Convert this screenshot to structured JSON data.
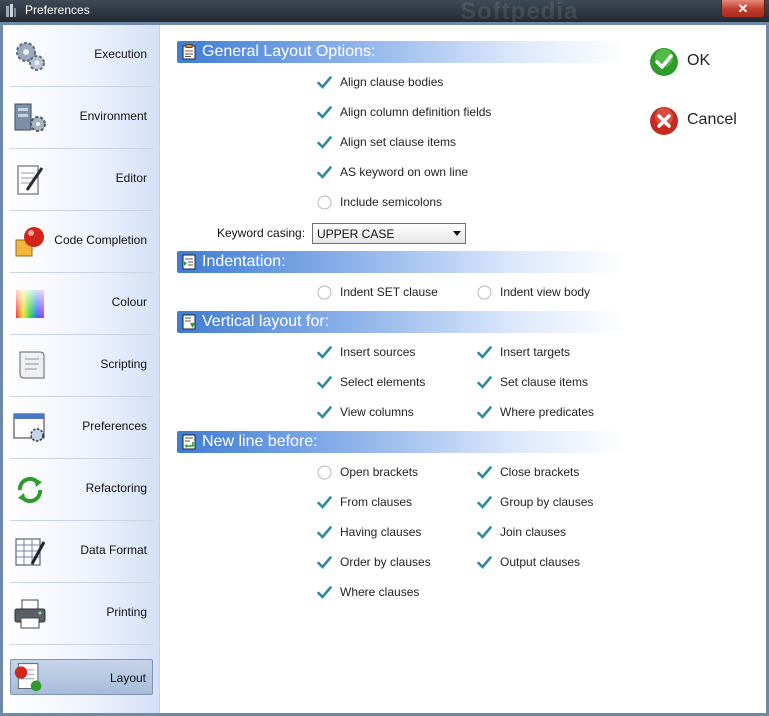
{
  "window": {
    "title": "Preferences",
    "watermark": "Softpedia"
  },
  "sidebar": {
    "items": [
      {
        "label": "Execution",
        "icon": "gears-icon"
      },
      {
        "label": "Environment",
        "icon": "server-gear-icon"
      },
      {
        "label": "Editor",
        "icon": "notepad-pen-icon"
      },
      {
        "label": "Code Completion",
        "icon": "cube-ball-icon"
      },
      {
        "label": "Colour",
        "icon": "color-gradient-icon"
      },
      {
        "label": "Scripting",
        "icon": "scroll-icon"
      },
      {
        "label": "Preferences",
        "icon": "window-gear-icon"
      },
      {
        "label": "Refactoring",
        "icon": "refresh-arrows-icon"
      },
      {
        "label": "Data Format",
        "icon": "spreadsheet-pen-icon"
      },
      {
        "label": "Printing",
        "icon": "printer-icon"
      },
      {
        "label": "Layout",
        "icon": "layout-doc-icon",
        "selected": true
      }
    ]
  },
  "sections": {
    "general": {
      "title": "General Layout Options:"
    },
    "indentation": {
      "title": "Indentation:"
    },
    "vertical": {
      "title": "Vertical layout for:"
    },
    "newline": {
      "title": "New line before:"
    }
  },
  "general_options": [
    {
      "label": "Align clause bodies",
      "type": "checkbox",
      "checked": true
    },
    {
      "label": "Align column definition fields",
      "type": "checkbox",
      "checked": true
    },
    {
      "label": "Align set clause items",
      "type": "checkbox",
      "checked": true
    },
    {
      "label": "AS keyword on own line",
      "type": "checkbox",
      "checked": true
    },
    {
      "label": "Include semicolons",
      "type": "checkbox",
      "checked": false
    }
  ],
  "keyword_casing": {
    "label": "Keyword casing:",
    "value": "UPPER CASE"
  },
  "indentation_options": [
    {
      "label": "Indent SET clause",
      "type": "checkbox",
      "checked": false
    },
    {
      "label": "Indent view body",
      "type": "checkbox",
      "checked": false
    }
  ],
  "vertical_options": [
    {
      "label": "Insert sources",
      "checked": true
    },
    {
      "label": "Insert targets",
      "checked": true
    },
    {
      "label": "Select elements",
      "checked": true
    },
    {
      "label": "Set clause items",
      "checked": true
    },
    {
      "label": "View columns",
      "checked": true
    },
    {
      "label": "Where predicates",
      "checked": true
    }
  ],
  "newline_options": [
    {
      "label": "Open brackets",
      "checked": false
    },
    {
      "label": "Close brackets",
      "checked": true
    },
    {
      "label": "From clauses",
      "checked": true
    },
    {
      "label": "Group by clauses",
      "checked": true
    },
    {
      "label": "Having clauses",
      "checked": true
    },
    {
      "label": "Join clauses",
      "checked": true
    },
    {
      "label": "Order by clauses",
      "checked": true
    },
    {
      "label": "Output clauses",
      "checked": true
    },
    {
      "label": "Where clauses",
      "checked": true
    }
  ],
  "buttons": {
    "ok": "OK",
    "cancel": "Cancel"
  },
  "colors": {
    "accent": "#3f7cd2",
    "check": "#2e8a9a",
    "ok_green": "#2f9b2a",
    "cancel_red": "#c62a1f"
  }
}
